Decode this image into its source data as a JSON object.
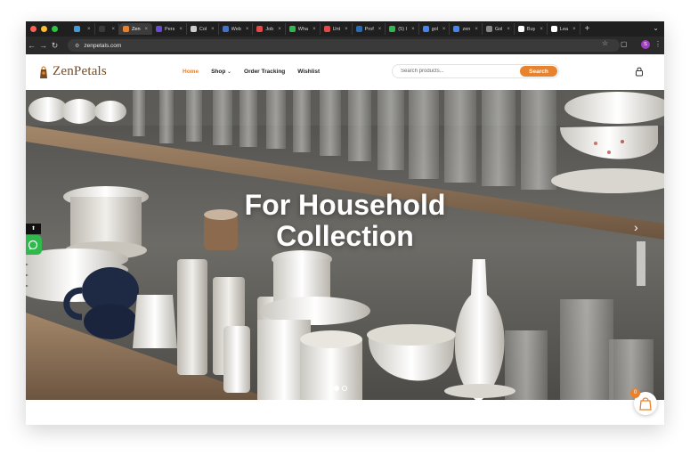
{
  "browser": {
    "tabs": [
      {
        "label": "",
        "favicon": "#3f9bde"
      },
      {
        "label": "",
        "favicon": "#3a3a3a"
      },
      {
        "label": "Zen",
        "favicon": "#e8822c",
        "active": true
      },
      {
        "label": "Pers",
        "favicon": "#6a4bd8"
      },
      {
        "label": "Col",
        "favicon": "#cccccc"
      },
      {
        "label": "Web",
        "favicon": "#4472c4"
      },
      {
        "label": "Job",
        "favicon": "#e24a4a"
      },
      {
        "label": "Wha",
        "favicon": "#2fb94d"
      },
      {
        "label": "Unt",
        "favicon": "#e24a4a"
      },
      {
        "label": "Prof",
        "favicon": "#2b6cb0"
      },
      {
        "label": "(5) I",
        "favicon": "#2fb94d"
      },
      {
        "label": "gol",
        "favicon": "#4285f4"
      },
      {
        "label": "zen",
        "favicon": "#4285f4"
      },
      {
        "label": "Gol",
        "favicon": "#888888"
      },
      {
        "label": "Buy",
        "favicon": "#ffffff"
      },
      {
        "label": "Lea",
        "favicon": "#ffffff"
      }
    ],
    "url": "zenpetals.com",
    "profile_initial": "S"
  },
  "site": {
    "logo_text": "ZenPetals",
    "nav": [
      {
        "label": "Home",
        "active": true
      },
      {
        "label": "Shop",
        "has_dropdown": true
      },
      {
        "label": "Order Tracking"
      },
      {
        "label": "Wishlist"
      }
    ],
    "search": {
      "placeholder": "Search products...",
      "button_label": "Search"
    },
    "accent_color": "#e8822c"
  },
  "hero": {
    "title_line1": "For Household",
    "title_line2": "Collection",
    "prev_arrow": "‹",
    "next_arrow": "›",
    "slide_count": 2,
    "active_slide": 1
  },
  "cart": {
    "count": "0"
  },
  "side_tab_label": "⬆"
}
